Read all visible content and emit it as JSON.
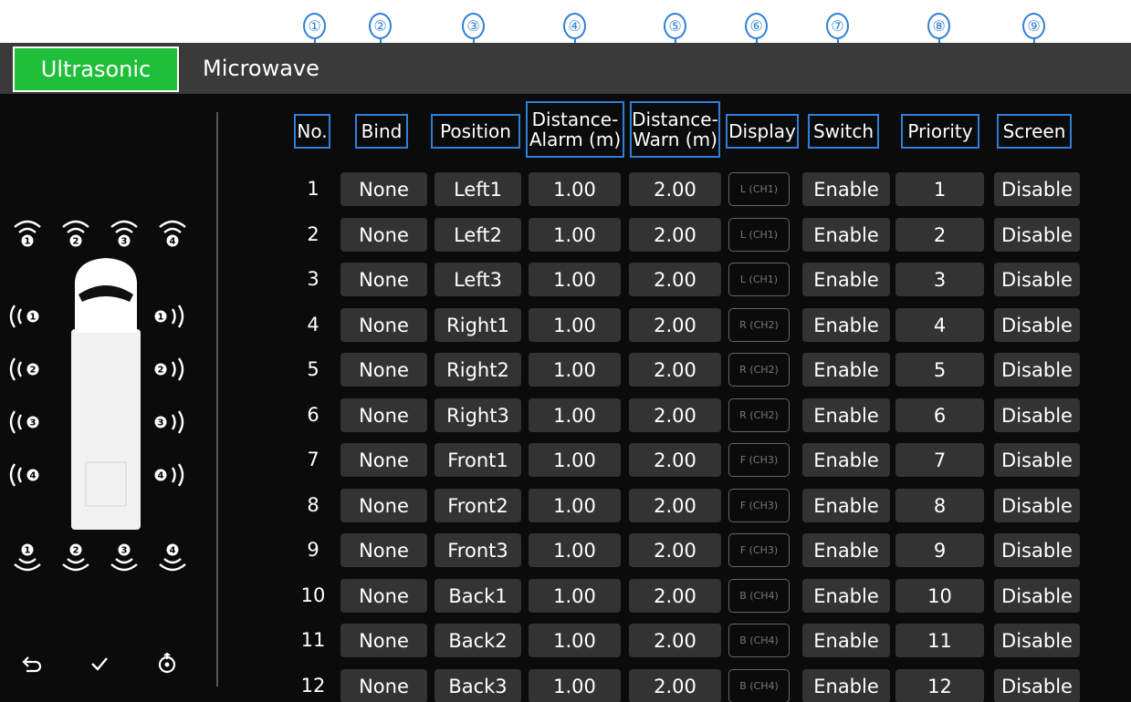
{
  "callouts": [
    "①",
    "②",
    "③",
    "④",
    "⑤",
    "⑥",
    "⑦",
    "⑧",
    "⑨"
  ],
  "tabs": {
    "active": "Ultrasonic",
    "inactive": "Microwave"
  },
  "headers": {
    "no": "No.",
    "bind": "Bind",
    "position": "Position",
    "alarm_line1": "Distance-",
    "alarm_line2": "Alarm (m)",
    "warn_line1": "Distance-",
    "warn_line2": "Warn (m)",
    "display": "Display",
    "switch": "Switch",
    "priority": "Priority",
    "screen": "Screen"
  },
  "rows": [
    {
      "no": "1",
      "bind": "None",
      "position": "Left1",
      "alarm": "1.00",
      "warn": "2.00",
      "display": "L (CH1)",
      "switch": "Enable",
      "priority": "1",
      "screen": "Disable"
    },
    {
      "no": "2",
      "bind": "None",
      "position": "Left2",
      "alarm": "1.00",
      "warn": "2.00",
      "display": "L (CH1)",
      "switch": "Enable",
      "priority": "2",
      "screen": "Disable"
    },
    {
      "no": "3",
      "bind": "None",
      "position": "Left3",
      "alarm": "1.00",
      "warn": "2.00",
      "display": "L (CH1)",
      "switch": "Enable",
      "priority": "3",
      "screen": "Disable"
    },
    {
      "no": "4",
      "bind": "None",
      "position": "Right1",
      "alarm": "1.00",
      "warn": "2.00",
      "display": "R (CH2)",
      "switch": "Enable",
      "priority": "4",
      "screen": "Disable"
    },
    {
      "no": "5",
      "bind": "None",
      "position": "Right2",
      "alarm": "1.00",
      "warn": "2.00",
      "display": "R (CH2)",
      "switch": "Enable",
      "priority": "5",
      "screen": "Disable"
    },
    {
      "no": "6",
      "bind": "None",
      "position": "Right3",
      "alarm": "1.00",
      "warn": "2.00",
      "display": "R (CH2)",
      "switch": "Enable",
      "priority": "6",
      "screen": "Disable"
    },
    {
      "no": "7",
      "bind": "None",
      "position": "Front1",
      "alarm": "1.00",
      "warn": "2.00",
      "display": "F (CH3)",
      "switch": "Enable",
      "priority": "7",
      "screen": "Disable"
    },
    {
      "no": "8",
      "bind": "None",
      "position": "Front2",
      "alarm": "1.00",
      "warn": "2.00",
      "display": "F (CH3)",
      "switch": "Enable",
      "priority": "8",
      "screen": "Disable"
    },
    {
      "no": "9",
      "bind": "None",
      "position": "Front3",
      "alarm": "1.00",
      "warn": "2.00",
      "display": "F (CH3)",
      "switch": "Enable",
      "priority": "9",
      "screen": "Disable"
    },
    {
      "no": "10",
      "bind": "None",
      "position": "Back1",
      "alarm": "1.00",
      "warn": "2.00",
      "display": "B (CH4)",
      "switch": "Enable",
      "priority": "10",
      "screen": "Disable"
    },
    {
      "no": "11",
      "bind": "None",
      "position": "Back2",
      "alarm": "1.00",
      "warn": "2.00",
      "display": "B (CH4)",
      "switch": "Enable",
      "priority": "11",
      "screen": "Disable"
    },
    {
      "no": "12",
      "bind": "None",
      "position": "Back3",
      "alarm": "1.00",
      "warn": "2.00",
      "display": "B (CH4)",
      "switch": "Enable",
      "priority": "12",
      "screen": "Disable"
    }
  ],
  "diagram": {
    "top_sensors": [
      "1",
      "2",
      "3",
      "4"
    ],
    "left_sensors": [
      "1",
      "2",
      "3",
      "4"
    ],
    "right_sensors": [
      "1",
      "2",
      "3",
      "4"
    ],
    "bottom_sensors": [
      "1",
      "2",
      "3",
      "4"
    ]
  },
  "toolbar_icons": [
    "back-icon",
    "check-icon",
    "reset-icon"
  ],
  "colors": {
    "accent": "#1fbf3a",
    "callout": "#2f7fd8",
    "cell": "#333333",
    "panel": "#0b0b0b"
  }
}
